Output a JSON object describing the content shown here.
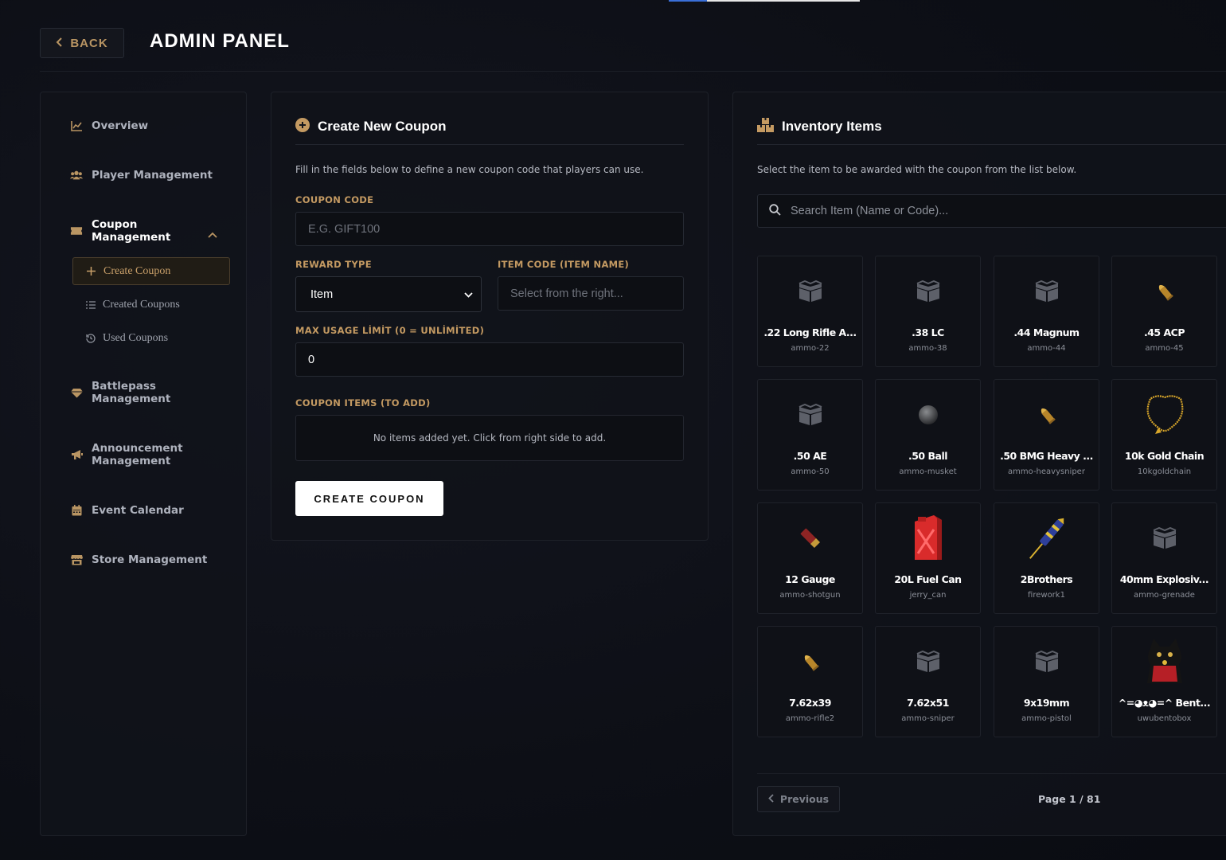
{
  "header": {
    "back_label": "BACK",
    "title": "ADMIN PANEL",
    "progress_fraction": 0.2
  },
  "sidebar": {
    "items": [
      {
        "label": "Overview",
        "icon": "chart-line-icon"
      },
      {
        "label": "Player Management",
        "icon": "users-icon"
      },
      {
        "label": "Coupon Management",
        "icon": "ticket-icon",
        "expanded": true
      },
      {
        "label": "Battlepass Management",
        "icon": "gem-icon"
      },
      {
        "label": "Announcement Management",
        "icon": "megaphone-icon"
      },
      {
        "label": "Event Calendar",
        "icon": "calendar-icon"
      },
      {
        "label": "Store Management",
        "icon": "store-icon"
      }
    ],
    "coupon_sub": [
      {
        "label": "Create Coupon",
        "icon": "plus-icon",
        "active": true
      },
      {
        "label": "Created Coupons",
        "icon": "list-icon"
      },
      {
        "label": "Used Coupons",
        "icon": "history-icon"
      }
    ]
  },
  "create": {
    "title": "Create New Coupon",
    "description": "Fill in the fields below to define a new coupon code that players can use.",
    "code_label": "COUPON CODE",
    "code_placeholder": "E.G. GIFT100",
    "reward_label": "REWARD TYPE",
    "reward_value": "Item",
    "item_code_label": "ITEM CODE (ITEM NAME)",
    "item_code_placeholder": "Select from the right...",
    "max_label": "MAX USAGE LİMİT (0 = UNLİMİTED)",
    "max_value": "0",
    "items_label": "COUPON ITEMS (TO ADD)",
    "items_empty": "No items added yet. Click from right side to add.",
    "button": "CREATE COUPON"
  },
  "inventory": {
    "title": "Inventory Items",
    "description": "Select the item to be awarded with the coupon from the list below.",
    "search_placeholder": "Search Item (Name or Code)...",
    "items": [
      {
        "name": ".22 Long Rifle A...",
        "code": "ammo-22",
        "icon": "box-icon"
      },
      {
        "name": ".38 LC",
        "code": "ammo-38",
        "icon": "box-icon"
      },
      {
        "name": ".44 Magnum",
        "code": "ammo-44",
        "icon": "box-icon"
      },
      {
        "name": ".45 ACP",
        "code": "ammo-45",
        "icon": "bullet-icon"
      },
      {
        "name": ".50 AE",
        "code": "ammo-50",
        "icon": "box-icon"
      },
      {
        "name": ".50 Ball",
        "code": "ammo-musket",
        "icon": "musket-ball-icon"
      },
      {
        "name": ".50 BMG Heavy ...",
        "code": "ammo-heavysniper",
        "icon": "bullet-icon"
      },
      {
        "name": "10k Gold Chain",
        "code": "10kgoldchain",
        "icon": "gold-chain-icon"
      },
      {
        "name": "12 Gauge",
        "code": "ammo-shotgun",
        "icon": "shotgun-shell-icon"
      },
      {
        "name": "20L Fuel Can",
        "code": "jerry_can",
        "icon": "jerry-can-icon"
      },
      {
        "name": "2Brothers",
        "code": "firework1",
        "icon": "firework-icon"
      },
      {
        "name": "40mm Explosiv...",
        "code": "ammo-grenade",
        "icon": "box-icon"
      },
      {
        "name": "7.62x39",
        "code": "ammo-rifle2",
        "icon": "bullet-icon"
      },
      {
        "name": "7.62x51",
        "code": "ammo-sniper",
        "icon": "box-icon"
      },
      {
        "name": "9x19mm",
        "code": "ammo-pistol",
        "icon": "box-icon"
      },
      {
        "name": "^=◕ᴥ◕=^ Bent...",
        "code": "uwubentobox",
        "icon": "lucky-cat-icon"
      }
    ],
    "prev_label": "Previous",
    "page_info": "Page 1 / 81"
  },
  "colors": {
    "accent": "#c49a62",
    "background": "#0d0f16",
    "panel": "#11131a"
  }
}
